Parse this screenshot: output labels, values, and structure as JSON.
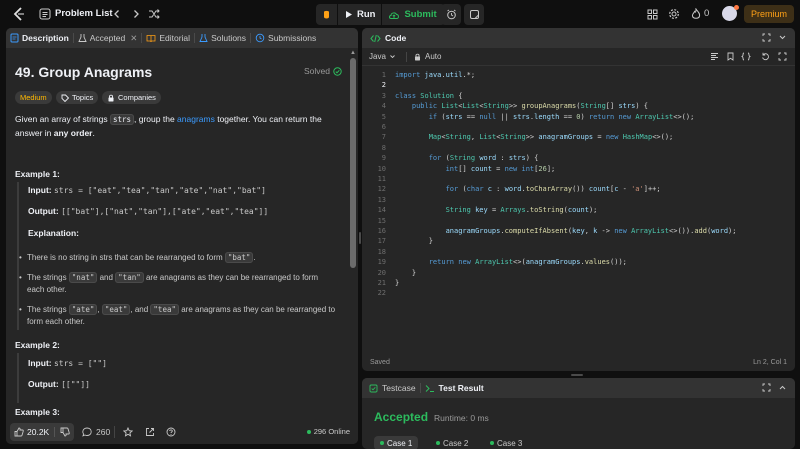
{
  "topbar": {
    "problem_list_label": "Problem List",
    "run_label": "Run",
    "submit_label": "Submit",
    "streak_count": "0",
    "premium_label": "Premium"
  },
  "description_panel": {
    "tabs": [
      {
        "label": "Description",
        "active": true
      },
      {
        "label": "Accepted",
        "active": false
      },
      {
        "label": "Editorial",
        "active": false
      },
      {
        "label": "Solutions",
        "active": false
      },
      {
        "label": "Submissions",
        "active": false
      }
    ],
    "title": "49. Group Anagrams",
    "solved_label": "Solved",
    "difficulty": "Medium",
    "topics_label": "Topics",
    "companies_label": "Companies",
    "statement": {
      "part1": "Given an array of strings ",
      "code": "strs",
      "part2": ", group the ",
      "link": "anagrams",
      "part3": " together. You can return the answer in ",
      "bold": "any order",
      "part4": "."
    },
    "example1": {
      "heading": "Example 1:",
      "input_label": "Input:",
      "input_value": "strs = [\"eat\",\"tea\",\"tan\",\"ate\",\"nat\",\"bat\"]",
      "output_label": "Output:",
      "output_value": "[[\"bat\"],[\"nat\",\"tan\"],[\"ate\",\"eat\",\"tea\"]]",
      "explanation_label": "Explanation:",
      "bullets": [
        {
          "a": "There is no string in strs that can be rearranged to form ",
          "c1": "\"bat\"",
          "b": "."
        },
        {
          "a": "The strings ",
          "c1": "\"nat\"",
          "m": " and ",
          "c2": "\"tan\"",
          "b": " are anagrams as they can be rearranged to form each other."
        },
        {
          "a": "The strings ",
          "c1": "\"ate\"",
          "m": ", ",
          "c2": "\"eat\"",
          "m2": ", and ",
          "c3": "\"tea\"",
          "b": " are anagrams as they can be rearranged to form each other."
        }
      ]
    },
    "example2": {
      "heading": "Example 2:",
      "input_label": "Input:",
      "input_value": "strs = [\"\"]",
      "output_label": "Output:",
      "output_value": "[[\"\"]]"
    },
    "example3": {
      "heading": "Example 3:"
    },
    "footer": {
      "likes": "20.2K",
      "comments": "260",
      "online": "296 Online"
    }
  },
  "code_panel": {
    "title": "Code",
    "language": "Java",
    "mode": "Auto",
    "status_left": "Saved",
    "status_right": "Ln 2, Col 1",
    "lines": [
      "import java.util.*;",
      "",
      "class Solution {",
      "    public List<List<String>> groupAnagrams(String[] strs) {",
      "        if (strs == null || strs.length == 0) return new ArrayList<>();",
      "",
      "        Map<String, List<String>> anagramGroups = new HashMap<>();",
      "",
      "        for (String word : strs) {",
      "            int[] count = new int[26];",
      "",
      "            for (char c : word.toCharArray()) count[c - 'a']++;",
      "",
      "            String key = Arrays.toString(count);",
      "",
      "            anagramGroups.computeIfAbsent(key, k -> new ArrayList<>()).add(word);",
      "        }",
      "",
      "        return new ArrayList<>(anagramGroups.values());",
      "    }",
      "}",
      ""
    ]
  },
  "test_panel": {
    "tabs": [
      {
        "label": "Testcase",
        "active": false
      },
      {
        "label": "Test Result",
        "active": true
      }
    ],
    "result": "Accepted",
    "runtime": "Runtime: 0 ms",
    "cases": [
      "Case 1",
      "Case 2",
      "Case 3"
    ]
  },
  "colors": {
    "accent_orange": "#ffa116",
    "success_green": "#2cbb5d",
    "panel_bg": "#262626",
    "page_bg": "#0f0f0f"
  }
}
